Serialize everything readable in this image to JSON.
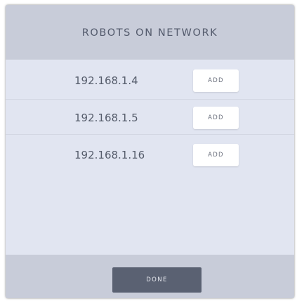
{
  "dialog": {
    "title": "ROBOTS ON NETWORK"
  },
  "robots": [
    {
      "ip": "192.168.1.4",
      "add_label": "ADD"
    },
    {
      "ip": "192.168.1.5",
      "add_label": "ADD"
    },
    {
      "ip": "192.168.1.16",
      "add_label": "ADD"
    }
  ],
  "footer": {
    "done_label": "DONE"
  },
  "colors": {
    "header_bg": "#c8ccd9",
    "list_bg": "#e1e5f1",
    "done_button_bg": "#5a6172"
  }
}
